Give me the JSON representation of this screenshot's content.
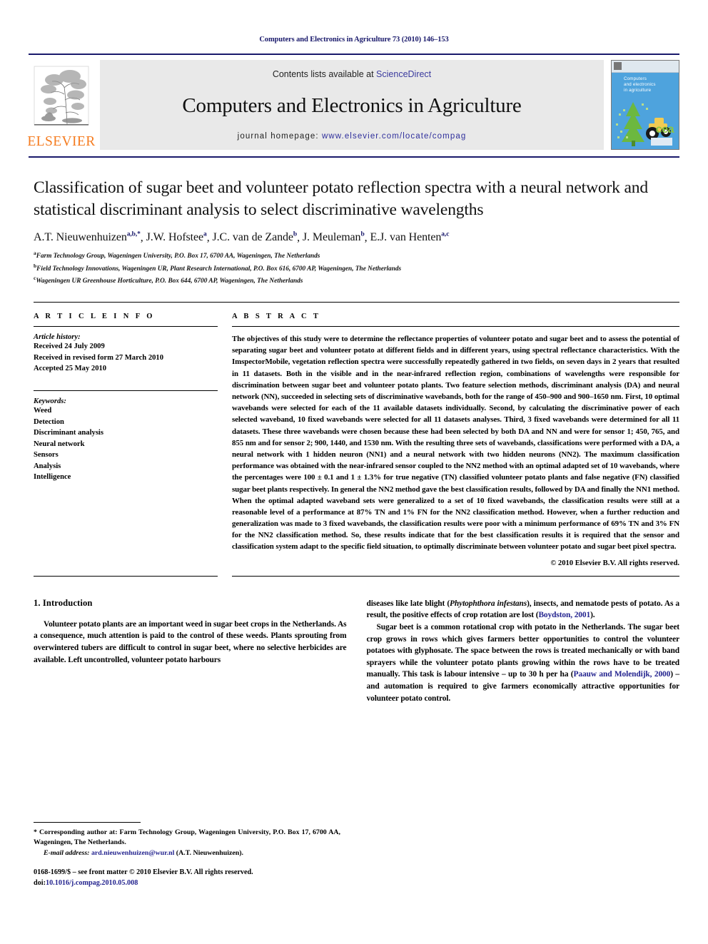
{
  "running_head": "Computers and Electronics in Agriculture 73 (2010) 146–153",
  "masthead": {
    "contents_prefix": "Contents lists available at ",
    "sciencedirect": "ScienceDirect",
    "journal_title": "Computers and Electronics in Agriculture",
    "homepage_prefix": "journal homepage: ",
    "homepage_url": "www.elsevier.com/locate/compag",
    "publisher": "ELSEVIER",
    "cover": {
      "title_lines": "Computers\nand electronics\nin agriculture",
      "logo_text": "cea"
    },
    "colors": {
      "rule": "#19196b",
      "link": "#3a3a9e",
      "elsevier_orange": "#f57c20",
      "cover_blue": "#4ea3dd",
      "cover_green": "#8cc63f"
    }
  },
  "article": {
    "title": "Classification of sugar beet and volunteer potato reflection spectra with a neural network and statistical discriminant analysis to select discriminative wavelengths",
    "authors": [
      {
        "name": "A.T. Nieuwenhuizen",
        "sup": "a,b,*"
      },
      {
        "name": "J.W. Hofstee",
        "sup": "a"
      },
      {
        "name": "J.C. van de Zande",
        "sup": "b"
      },
      {
        "name": "J. Meuleman",
        "sup": "b"
      },
      {
        "name": "E.J. van Henten",
        "sup": "a,c"
      }
    ],
    "affiliations": [
      {
        "mark": "a",
        "text": "Farm Technology Group, Wageningen University, P.O. Box 17, 6700 AA, Wageningen, The Netherlands"
      },
      {
        "mark": "b",
        "text": "Field Technology Innovations, Wageningen UR, Plant Research International, P.O. Box 616, 6700 AP, Wageningen, The Netherlands"
      },
      {
        "mark": "c",
        "text": "Wageningen UR Greenhouse Horticulture, P.O. Box 644, 6700 AP, Wageningen, The Netherlands"
      }
    ]
  },
  "article_info": {
    "heading": "A R T I C L E   I N F O",
    "history_label": "Article history:",
    "history": [
      "Received 24 July 2009",
      "Received in revised form 27 March 2010",
      "Accepted 25 May 2010"
    ],
    "keywords_label": "Keywords:",
    "keywords": [
      "Weed",
      "Detection",
      "Discriminant analysis",
      "Neural network",
      "Sensors",
      "Analysis",
      "Intelligence"
    ]
  },
  "abstract": {
    "heading": "A B S T R A C T",
    "text": "The objectives of this study were to determine the reflectance properties of volunteer potato and sugar beet and to assess the potential of separating sugar beet and volunteer potato at different fields and in different years, using spectral reflectance characteristics. With the ImspectorMobile, vegetation reflection spectra were successfully repeatedly gathered in two fields, on seven days in 2 years that resulted in 11 datasets. Both in the visible and in the near-infrared reflection region, combinations of wavelengths were responsible for discrimination between sugar beet and volunteer potato plants. Two feature selection methods, discriminant analysis (DA) and neural network (NN), succeeded in selecting sets of discriminative wavebands, both for the range of 450–900 and 900–1650 nm. First, 10 optimal wavebands were selected for each of the 11 available datasets individually. Second, by calculating the discriminative power of each selected waveband, 10 fixed wavebands were selected for all 11 datasets analyses. Third, 3 fixed wavebands were determined for all 11 datasets. These three wavebands were chosen because these had been selected by both DA and NN and were for sensor 1; 450, 765, and 855 nm and for sensor 2; 900, 1440, and 1530 nm. With the resulting three sets of wavebands, classifications were performed with a DA, a neural network with 1 hidden neuron (NN1) and a neural network with two hidden neurons (NN2). The maximum classification performance was obtained with the near-infrared sensor coupled to the NN2 method with an optimal adapted set of 10 wavebands, where the percentages were 100 ± 0.1 and 1 ± 1.3% for true negative (TN) classified volunteer potato plants and false negative (FN) classified sugar beet plants respectively. In general the NN2 method gave the best classification results, followed by DA and finally the NN1 method. When the optimal adapted waveband sets were generalized to a set of 10 fixed wavebands, the classification results were still at a reasonable level of a performance at 87% TN and 1% FN for the NN2 classification method. However, when a further reduction and generalization was made to 3 fixed wavebands, the classification results were poor with a minimum performance of 69% TN and 3% FN for the NN2 classification method. So, these results indicate that for the best classification results it is required that the sensor and classification system adapt to the specific field situation, to optimally discriminate between volunteer potato and sugar beet pixel spectra.",
    "copyright": "© 2010 Elsevier B.V. All rights reserved."
  },
  "body": {
    "section_heading": "1. Introduction",
    "left_paragraph": "Volunteer potato plants are an important weed in sugar beet crops in the Netherlands. As a consequence, much attention is paid to the control of these weeds. Plants sprouting from overwintered tubers are difficult to control in sugar beet, where no selective herbicides are available. Left uncontrolled, volunteer potato harbours",
    "right_paragraph_1_pre": "diseases like late blight (",
    "right_paragraph_1_italic": "Phytophthora infestans",
    "right_paragraph_1_mid": "), insects, and nematode pests of potato. As a result, the positive effects of crop rotation are lost (",
    "right_paragraph_1_cite": "Boydston, 2001",
    "right_paragraph_1_post": ").",
    "right_paragraph_2_pre": "Sugar beet is a common rotational crop with potato in the Netherlands. The sugar beet crop grows in rows which gives farmers better opportunities to control the volunteer potatoes with glyphosate. The space between the rows is treated mechanically or with band sprayers while the volunteer potato plants growing within the rows have to be treated manually. This task is labour intensive – up to 30 h per ha (",
    "right_paragraph_2_cite": "Paauw and Molendijk, 2000",
    "right_paragraph_2_post": ") – and automation is required to give farmers economically attractive opportunities for volunteer potato control."
  },
  "footnotes": {
    "corresponding": "* Corresponding author at: Farm Technology Group, Wageningen University, P.O. Box 17, 6700 AA, Wageningen, The Netherlands.",
    "email_label": "E-mail address:",
    "email": "ard.nieuwenhuizen@wur.nl",
    "email_suffix": "(A.T. Nieuwenhuizen).",
    "issn_line": "0168-1699/$ – see front matter © 2010 Elsevier B.V. All rights reserved.",
    "doi_label": "doi:",
    "doi": "10.1016/j.compag.2010.05.008"
  }
}
